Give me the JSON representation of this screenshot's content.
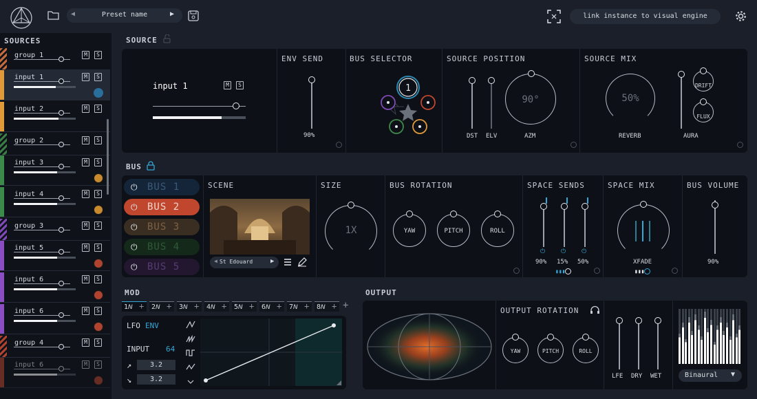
{
  "topbar": {
    "preset_name": "Preset name",
    "link_button": "link instance to visual engine"
  },
  "sources": {
    "title": "SOURCES",
    "items": [
      {
        "name": "group 1",
        "kind": "group",
        "color": "#c26b3e",
        "vol": 0
      },
      {
        "name": "input 1",
        "kind": "input",
        "color": "#e09a3a",
        "vol": 0.68,
        "dot": "#2a6f9c",
        "selected": true
      },
      {
        "name": "input 2",
        "kind": "input",
        "color": "#e09a3a",
        "vol": 0.72,
        "dot": ""
      },
      {
        "name": "group 2",
        "kind": "group",
        "color": "#3b7d46",
        "vol": 0
      },
      {
        "name": "input 3",
        "kind": "input",
        "color": "#3b8a4a",
        "vol": 0.7,
        "dot": "#c98a2d"
      },
      {
        "name": "input 4",
        "kind": "input",
        "color": "#3b8a4a",
        "vol": 0.7,
        "dot": "#c98a2d"
      },
      {
        "name": "group 3",
        "kind": "group",
        "color": "#7f4ab8",
        "vol": 0
      },
      {
        "name": "input 5",
        "kind": "input",
        "color": "#8a4ec2",
        "vol": 0.7,
        "dot": "#b0432f"
      },
      {
        "name": "input 6",
        "kind": "input",
        "color": "#8a4ec2",
        "vol": 0.7,
        "dot": "#b0432f"
      },
      {
        "name": "input 6",
        "kind": "input",
        "color": "#8a4ec2",
        "vol": 0.7,
        "dot": "#b0432f"
      },
      {
        "name": "group 4",
        "kind": "group",
        "color": "#b0432f",
        "vol": 0
      },
      {
        "name": "input 6",
        "kind": "input",
        "color": "#b0432f",
        "vol": 0.7,
        "dot": "#b0432f",
        "dim": true
      }
    ],
    "m": "M",
    "s": "S"
  },
  "source": {
    "title": "SOURCE",
    "input_name": "input 1",
    "m": "M",
    "s": "S",
    "env_send": {
      "title": "ENV SEND",
      "value": "90%"
    },
    "bus_selector": {
      "title": "BUS SELECTOR",
      "center": "1"
    },
    "position": {
      "title": "SOURCE POSITION",
      "dst": "DST",
      "elv": "ELV",
      "azm": "AZM",
      "azm_value": "90°"
    },
    "mix": {
      "title": "SOURCE MIX",
      "reverb": "REVERB",
      "reverb_value": "50%",
      "aura": "AURA",
      "drift": "DRIFT",
      "flux": "FLUX"
    }
  },
  "bus": {
    "title": "BUS",
    "buses": [
      {
        "label": "BUS 1",
        "bg": "#14253a",
        "fg": "#3a5a78",
        "active": false
      },
      {
        "label": "BUS 2",
        "bg": "#c0472e",
        "fg": "#f4d6cb",
        "active": true
      },
      {
        "label": "BUS 3",
        "bg": "#3a2e22",
        "fg": "#7d6244",
        "active": false
      },
      {
        "label": "BUS 4",
        "bg": "#14291a",
        "fg": "#2f5a38",
        "active": false
      },
      {
        "label": "BUS 5",
        "bg": "#23172f",
        "fg": "#563d73",
        "active": false
      }
    ],
    "scene": {
      "title": "SCENE",
      "name": "St Edouard"
    },
    "size": {
      "title": "SIZE",
      "value": "1X"
    },
    "rotation": {
      "title": "BUS ROTATION",
      "yaw": "YAW",
      "pitch": "PITCH",
      "roll": "ROLL"
    },
    "sends": {
      "title": "SPACE SENDS",
      "v1": "90%",
      "v2": "15%",
      "v3": "50%"
    },
    "spacemix": {
      "title": "SPACE MIX",
      "xfade": "XFADE"
    },
    "volume": {
      "title": "BUS VOLUME",
      "value": "90%"
    }
  },
  "mod": {
    "title": "MOD",
    "lfos": [
      "1",
      "2",
      "3",
      "4",
      "5",
      "6",
      "7",
      "8"
    ],
    "lfo_label": "LFO",
    "env_label": "ENV",
    "input_label": "INPUT",
    "input_value": "64",
    "rise": "3.2",
    "fall": "3.2"
  },
  "output": {
    "title": "OUTPUT",
    "rotation_title": "OUTPUT ROTATION",
    "yaw": "YAW",
    "pitch": "PITCH",
    "roll": "ROLL",
    "lfe": "LFE",
    "dry": "DRY",
    "wet": "WET",
    "mode": "Binaural",
    "meter_levels": [
      0.55,
      0.75,
      0.45,
      0.85,
      0.6,
      0.9,
      0.7,
      0.5,
      0.95,
      0.65,
      0.8,
      0.4,
      0.7,
      0.85,
      0.6,
      0.75,
      0.5,
      0.9,
      0.55,
      0.7
    ]
  }
}
